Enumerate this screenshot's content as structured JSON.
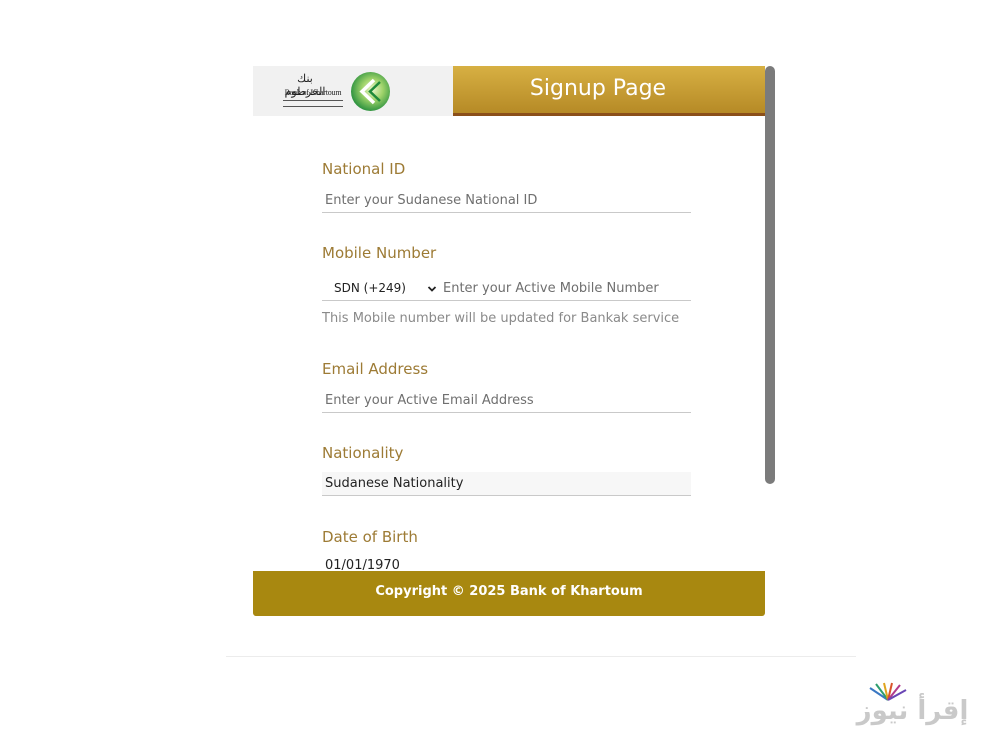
{
  "header": {
    "title": "Signup Page",
    "logo_arabic": "بنك الخرطوم",
    "logo_english": "Bank of Khartoum"
  },
  "form": {
    "national_id": {
      "label": "National ID",
      "placeholder": "Enter your Sudanese National ID"
    },
    "mobile": {
      "label": "Mobile Number",
      "country_code": "SDN (+249)",
      "placeholder": "Enter your Active Mobile Number",
      "helper": "This Mobile number will be updated for Bankak service"
    },
    "email": {
      "label": "Email Address",
      "placeholder": "Enter your Active Email Address"
    },
    "nationality": {
      "label": "Nationality",
      "value": "Sudanese Nationality"
    },
    "dob": {
      "label": "Date of Birth",
      "value": "01/01/1970"
    }
  },
  "footer": {
    "copyright": "Copyright © 2025 Bank of Khartoum"
  },
  "watermark": {
    "text": "إقرأ نيوز"
  },
  "colors": {
    "label_gold": "#9d7b35",
    "banner_gold": "#c39a2d",
    "banner_edge": "#8b4f1a",
    "footer_gold": "#a88810",
    "logo_green": "#2fa84f"
  }
}
